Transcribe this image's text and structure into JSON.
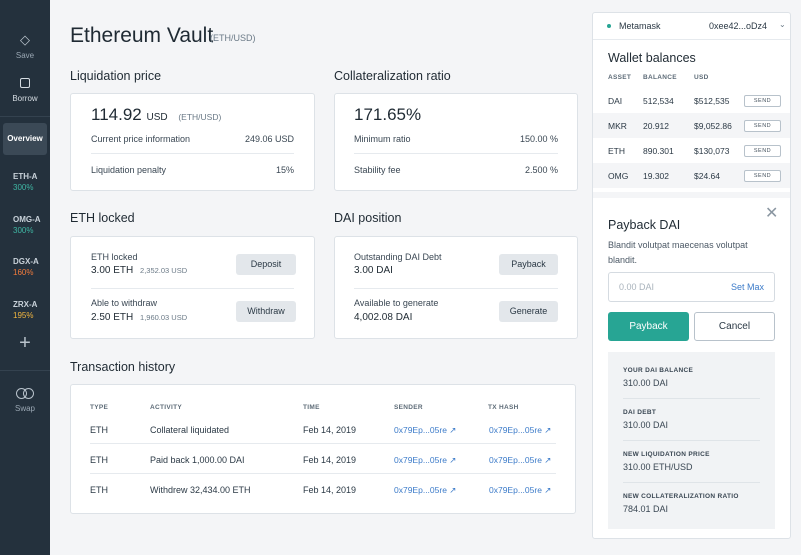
{
  "sidebar": {
    "save_label": "Save",
    "borrow_label": "Borrow",
    "overview_label": "Overview",
    "ilks": [
      {
        "name": "ETH-A",
        "pct": "300%",
        "color": "#3fb6a3"
      },
      {
        "name": "OMG-A",
        "pct": "300%",
        "color": "#3fb6a3"
      },
      {
        "name": "DGX-A",
        "pct": "160%",
        "color": "#f07a3c"
      },
      {
        "name": "ZRX-A",
        "pct": "195%",
        "color": "#f2b640"
      }
    ],
    "swap_label": "Swap"
  },
  "header": {
    "title": "Ethereum Vault",
    "pair": "(ETH/USD)"
  },
  "liquidation": {
    "title": "Liquidation price",
    "price": "114.92",
    "currency": "USD",
    "pair": "(ETH/USD)",
    "current_label": "Current price information",
    "current_value": "249.06 USD",
    "penalty_label": "Liquidation penalty",
    "penalty_value": "15%"
  },
  "collateralization": {
    "title": "Collateralization ratio",
    "ratio": "171.65%",
    "min_label": "Minimum ratio",
    "min_value": "150.00 %",
    "fee_label": "Stability fee",
    "fee_value": "2.500 %"
  },
  "eth_locked": {
    "title": "ETH locked",
    "locked_label": "ETH locked",
    "locked_value": "3.00 ETH",
    "locked_usd": "2,352.03 USD",
    "deposit_label": "Deposit",
    "withdraw_able_label": "Able to withdraw",
    "withdraw_value": "2.50 ETH",
    "withdraw_usd": "1,960.03 USD",
    "withdraw_label": "Withdraw"
  },
  "dai_position": {
    "title": "DAI position",
    "debt_label": "Outstanding DAI Debt",
    "debt_value": "3.00 DAI",
    "payback_label": "Payback",
    "available_label": "Available to generate",
    "available_value": "4,002.08 DAI",
    "generate_label": "Generate"
  },
  "transactions": {
    "title": "Transaction history",
    "headers": [
      "TYPE",
      "ACTIVITY",
      "TIME",
      "SENDER",
      "TX HASH"
    ],
    "rows": [
      {
        "type": "ETH",
        "activity": "Collateral liquidated",
        "time": "Feb 14, 2019",
        "sender": "0x79Ep...05re ↗",
        "hash": "0x79Ep...05re ↗"
      },
      {
        "type": "ETH",
        "activity": "Paid back 1,000.00 DAI",
        "time": "Feb 14, 2019",
        "sender": "0x79Ep...05re ↗",
        "hash": "0x79Ep...05re ↗"
      },
      {
        "type": "ETH",
        "activity": "Withdrew 32,434.00 ETH",
        "time": "Feb 14, 2019",
        "sender": "0x79Ep...05re ↗",
        "hash": "0x79Ep...05re ↗"
      }
    ]
  },
  "wallet": {
    "provider": "Metamask",
    "address": "0xee42...oDz4",
    "title": "Wallet balances",
    "headers": [
      "ASSET",
      "BALANCE",
      "USD"
    ],
    "rows": [
      {
        "asset": "DAI",
        "balance": "512,534",
        "usd": "$512,535",
        "send": "SEND"
      },
      {
        "asset": "MKR",
        "balance": "20.912",
        "usd": "$9,052.86",
        "send": "SEND"
      },
      {
        "asset": "ETH",
        "balance": "890.301",
        "usd": "$130,073",
        "send": "SEND"
      },
      {
        "asset": "OMG",
        "balance": "19.302",
        "usd": "$24.64",
        "send": "SEND"
      }
    ]
  },
  "payback": {
    "title": "Payback DAI",
    "description": "Blandit volutpat maecenas volutpat blandit.",
    "input_placeholder": "0.00 DAI",
    "set_max_label": "Set Max",
    "payback_button": "Payback",
    "cancel_button": "Cancel",
    "summary": [
      {
        "label": "YOUR DAI BALANCE",
        "value": "310.00 DAI"
      },
      {
        "label": "DAI DEBT",
        "value": "310.00 DAI"
      },
      {
        "label": "NEW LIQUIDATION PRICE",
        "value": "310.00 ETH/USD"
      },
      {
        "label": "NEW COLLATERALIZATION RATIO",
        "value": "784.01 DAI"
      }
    ]
  },
  "colors": {
    "accent": "#27a594",
    "link": "#3c7bc9",
    "sidebar": "#24313d"
  }
}
